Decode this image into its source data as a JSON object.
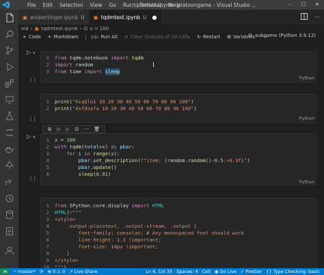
{
  "window": {
    "menu": [
      "File",
      "Edit",
      "Selection",
      "View",
      "Go",
      "Run",
      "Terminal",
      "Help"
    ],
    "title": "tqdmtest.ipynb - platoongame - Visual Studio ..."
  },
  "tabs": [
    {
      "label": "wolpertinger.ipynb",
      "status": "U"
    },
    {
      "label": "tqdmtest.ipynb",
      "status": "U",
      "dirty": "●"
    }
  ],
  "breadcrumb": {
    "folder": "old",
    "file": "tqdmtest.ipynb",
    "cell": "x = 100"
  },
  "toolbar": {
    "code": "Code",
    "markdown": "Markdown",
    "run_all": "Run All",
    "clear_outputs": "Clear Outputs of All Cells",
    "restart": "Restart",
    "variables": "Variables",
    "kernel": "subgame (Python 3.9.12)"
  },
  "cells": [
    {
      "bracket": "[ ]",
      "lang": "Python"
    },
    {
      "bracket": "[ ]",
      "lang": "Python"
    },
    {
      "bracket": "[ ]",
      "lang": "Python"
    },
    {
      "bracket": "",
      "lang": ""
    }
  ],
  "statusbar": {
    "branch": "master*",
    "errors": "0",
    "warnings": "0",
    "live_share": "Live Share",
    "position": "Ln 6, Col 35",
    "spaces": "Spaces: 4",
    "cell_type": "Cell",
    "go_live": "Go Live",
    "prettier": "Prettier",
    "type_checking": "Type Checking: basic"
  },
  "colors": {
    "accent": "#007acc",
    "remote": "#16825d",
    "editor_bg": "#1e1e1e",
    "cell_bg": "#262626"
  }
}
